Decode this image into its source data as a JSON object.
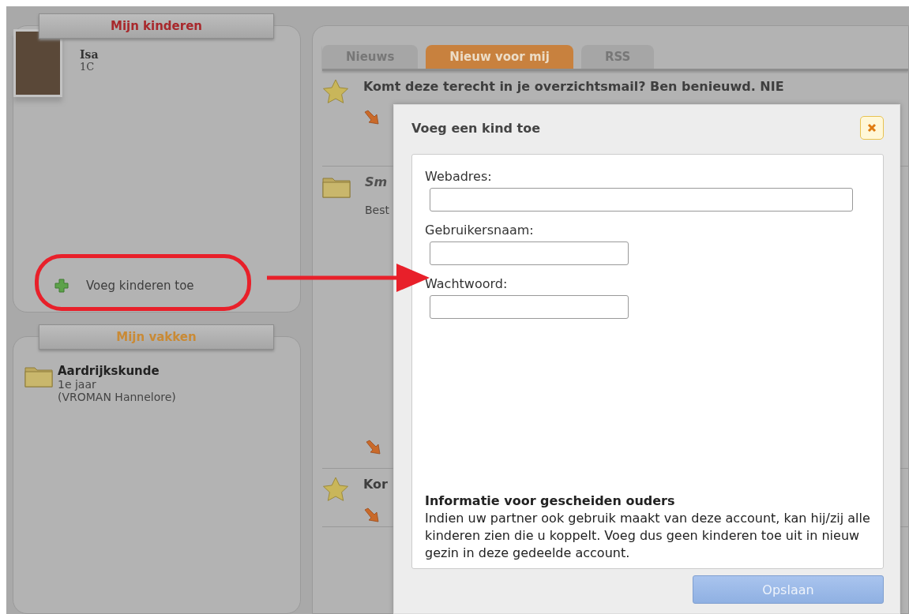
{
  "sidebar": {
    "children_panel": {
      "title": "Mijn kinderen",
      "children": [
        {
          "name": "Isa",
          "class": "1C"
        }
      ],
      "add_link": "Voeg kinderen toe"
    },
    "subjects_panel": {
      "title": "Mijn vakken",
      "subjects": [
        {
          "name": "Aardrijkskunde",
          "year": "1e jaar",
          "teacher": "(VROMAN Hannelore)"
        }
      ]
    }
  },
  "tabs": [
    {
      "label": "Nieuws",
      "selected": false
    },
    {
      "label": "Nieuw voor mij",
      "selected": true
    },
    {
      "label": "RSS",
      "selected": false
    }
  ],
  "feed": [
    {
      "kind": "starred",
      "title": "Komt deze terecht in je overzichtsmail? Ben benieuwd. NIE"
    },
    {
      "kind": "folder",
      "title": "Sm",
      "excerpt": "Best"
    },
    {
      "kind": "starred",
      "title": "Kor"
    }
  ],
  "dialog": {
    "title": "Voeg een kind toe",
    "fields": [
      {
        "label": "Webadres:",
        "kind": "wide"
      },
      {
        "label": "Gebruikersnaam:",
        "kind": "short"
      },
      {
        "label": "Wachtwoord:",
        "kind": "short"
      }
    ],
    "info_title": "Informatie voor gescheiden ouders",
    "info_text": "Indien uw partner ook gebruik maakt van deze account, kan hij/zij alle kinderen zien die u koppelt. Voeg dus geen kinderen toe uit in nieuw gezin in deze gedeelde account.",
    "save_button": "Opslaan"
  }
}
